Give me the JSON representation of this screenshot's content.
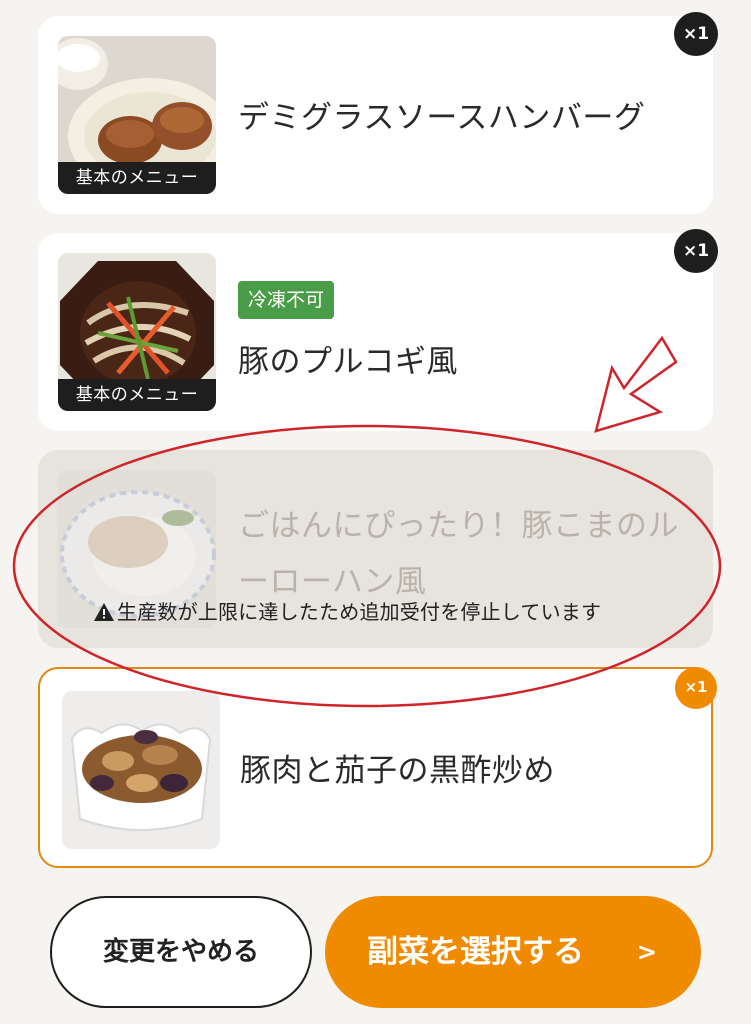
{
  "items": [
    {
      "title": "デミグラスソースハンバーグ",
      "badge": "基本のメニュー",
      "quantity": "×1"
    },
    {
      "title": "豚のプルコギ風",
      "badge": "基本のメニュー",
      "tag": "冷凍不可",
      "quantity": "×1"
    },
    {
      "title": "ごはんにぴったり！豚こまのルーローハン風",
      "notice": "生産数が上限に達したため追加受付を停止しています"
    },
    {
      "title": "豚肉と茄子の黒酢炒め",
      "quantity": "×1"
    }
  ],
  "buttons": {
    "cancel_label": "変更をやめる",
    "primary_label": "副菜を選択する",
    "primary_chevron": ">"
  },
  "colors": {
    "accent": "#f08a00",
    "tag_green": "#4a9d48",
    "annotation_red": "#d0242b",
    "selected_border": "#e08a12"
  },
  "icons": {
    "quantity": "quantity-badge",
    "warning": "warning-icon",
    "annotation": "red-arrow-icon"
  }
}
